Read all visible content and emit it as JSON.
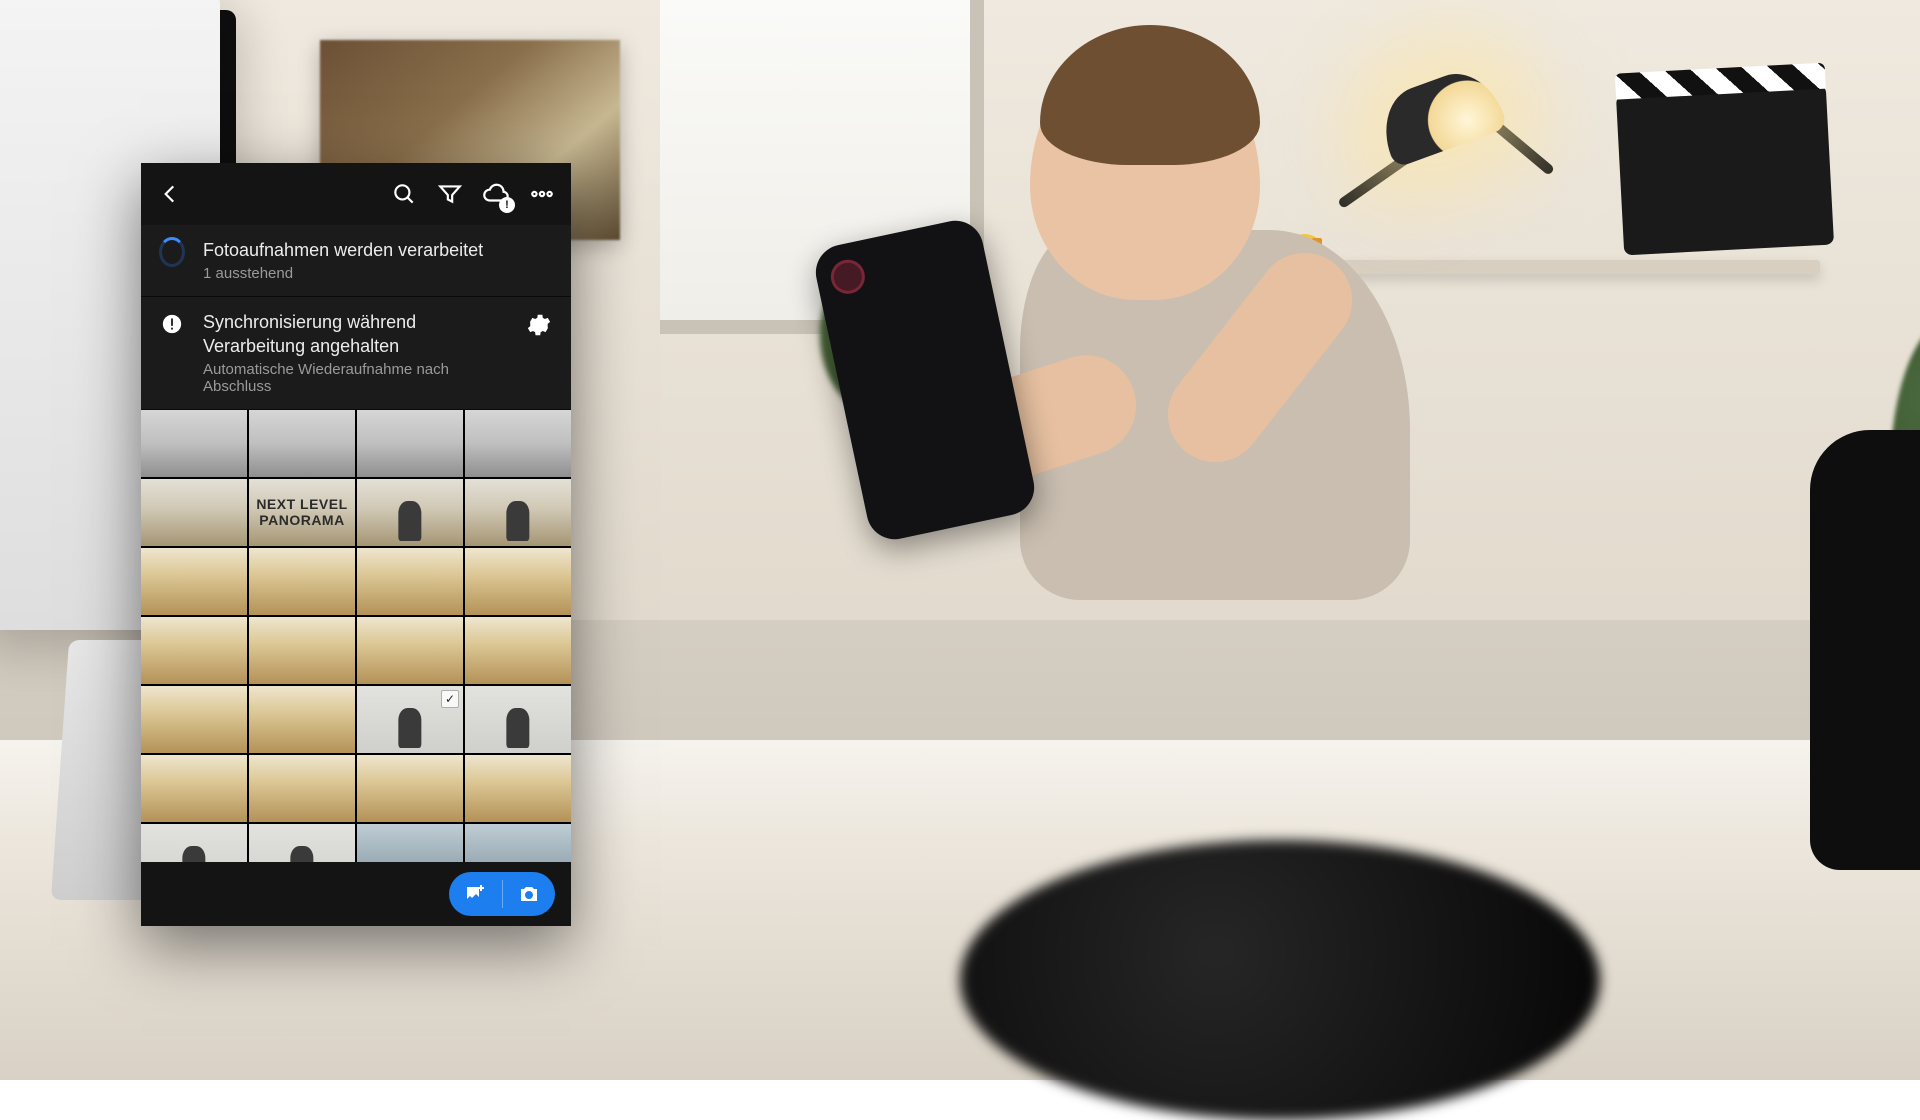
{
  "topbar": {
    "back_icon": "chevron-left",
    "search_icon": "search",
    "filter_icon": "filter",
    "cloud_icon": "cloud-sync",
    "cloud_badge": "!",
    "more_icon": "more-horizontal"
  },
  "status": {
    "processing": {
      "icon": "spinner",
      "title": "Fotoaufnahmen werden verarbeitet",
      "subtitle": "1 ausstehend"
    },
    "sync_paused": {
      "icon": "alert-circle",
      "title": "Synchronisierung während Verarbeitung angehalten",
      "subtitle": "Automatische Wiederaufnahme nach Abschluss",
      "action_icon": "gear"
    }
  },
  "grid": {
    "overlay_label": "NEXT LEVEL PANORAMA",
    "thumbnails": [
      {
        "tone": "gray"
      },
      {
        "tone": "gray"
      },
      {
        "tone": "gray"
      },
      {
        "tone": "gray"
      },
      {
        "tone": "land"
      },
      {
        "tone": "land",
        "label": true
      },
      {
        "tone": "land",
        "silhouette": true
      },
      {
        "tone": "land",
        "silhouette": true
      },
      {
        "tone": "warm"
      },
      {
        "tone": "warm"
      },
      {
        "tone": "warm"
      },
      {
        "tone": "warm"
      },
      {
        "tone": "warm"
      },
      {
        "tone": "warm"
      },
      {
        "tone": "warm"
      },
      {
        "tone": "warm"
      },
      {
        "tone": "warm"
      },
      {
        "tone": "warm"
      },
      {
        "tone": "fig",
        "silhouette": true,
        "checked": true
      },
      {
        "tone": "fig",
        "silhouette": true
      },
      {
        "tone": "warm"
      },
      {
        "tone": "warm"
      },
      {
        "tone": "warm"
      },
      {
        "tone": "warm"
      },
      {
        "tone": "fig",
        "silhouette": true
      },
      {
        "tone": "fig",
        "silhouette": true
      },
      {
        "tone": "portrait"
      },
      {
        "tone": "portrait"
      }
    ]
  },
  "bottombar": {
    "add_photos_icon": "image-plus",
    "camera_icon": "camera"
  },
  "colors": {
    "accent": "#1d7ef0",
    "panel": "#141414",
    "panel_alt": "#1b1b1b",
    "text": "#ececec",
    "text_muted": "#9a9a9a"
  }
}
